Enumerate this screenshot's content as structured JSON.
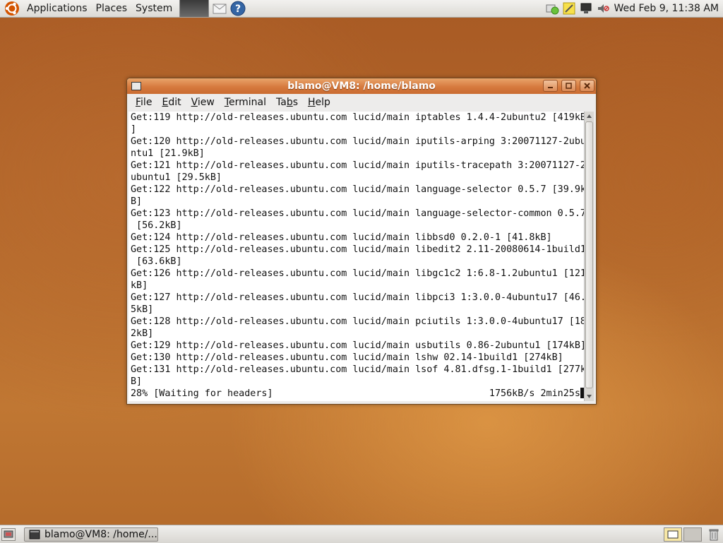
{
  "top_panel": {
    "menus": [
      "Applications",
      "Places",
      "System"
    ],
    "launchers": [
      "terminal-icon",
      "mail-icon",
      "help-icon"
    ],
    "tray": [
      "network-icon",
      "notes-icon",
      "display-icon",
      "volume-icon"
    ],
    "clock": "Wed Feb  9, 11:38 AM"
  },
  "window": {
    "title": "blamo@VM8: /home/blamo",
    "menu": [
      {
        "mnemonic": "F",
        "rest": "ile"
      },
      {
        "mnemonic": "E",
        "rest": "dit"
      },
      {
        "mnemonic": "V",
        "rest": "iew"
      },
      {
        "mnemonic": "T",
        "rest": "erminal"
      },
      {
        "mnemonic": "",
        "pre": "Ta",
        "mn": "b",
        "post": "s"
      },
      {
        "mnemonic": "H",
        "rest": "elp"
      }
    ],
    "terminal_lines": [
      "Get:119 http://old-releases.ubuntu.com lucid/main iptables 1.4.4-2ubuntu2 [419kB",
      "]",
      "Get:120 http://old-releases.ubuntu.com lucid/main iputils-arping 3:20071127-2ubu",
      "ntu1 [21.9kB]",
      "Get:121 http://old-releases.ubuntu.com lucid/main iputils-tracepath 3:20071127-2",
      "ubuntu1 [29.5kB]",
      "Get:122 http://old-releases.ubuntu.com lucid/main language-selector 0.5.7 [39.9k",
      "B]",
      "Get:123 http://old-releases.ubuntu.com lucid/main language-selector-common 0.5.7",
      " [56.2kB]",
      "Get:124 http://old-releases.ubuntu.com lucid/main libbsd0 0.2.0-1 [41.8kB]",
      "Get:125 http://old-releases.ubuntu.com lucid/main libedit2 2.11-20080614-1build1",
      " [63.6kB]",
      "Get:126 http://old-releases.ubuntu.com lucid/main libgc1c2 1:6.8-1.2ubuntu1 [121",
      "kB]",
      "Get:127 http://old-releases.ubuntu.com lucid/main libpci3 1:3.0.0-4ubuntu17 [46.",
      "5kB]",
      "Get:128 http://old-releases.ubuntu.com lucid/main pciutils 1:3.0.0-4ubuntu17 [18",
      "2kB]",
      "Get:129 http://old-releases.ubuntu.com lucid/main usbutils 0.86-2ubuntu1 [174kB]",
      "Get:130 http://old-releases.ubuntu.com lucid/main lshw 02.14-1build1 [274kB]",
      "Get:131 http://old-releases.ubuntu.com lucid/main lsof 4.81.dfsg.1-1build1 [277k",
      "B]"
    ],
    "status_line": "28% [Waiting for headers]                                      1756kB/s 2min25s"
  },
  "bottom_panel": {
    "task_label": "blamo@VM8: /home/..."
  }
}
